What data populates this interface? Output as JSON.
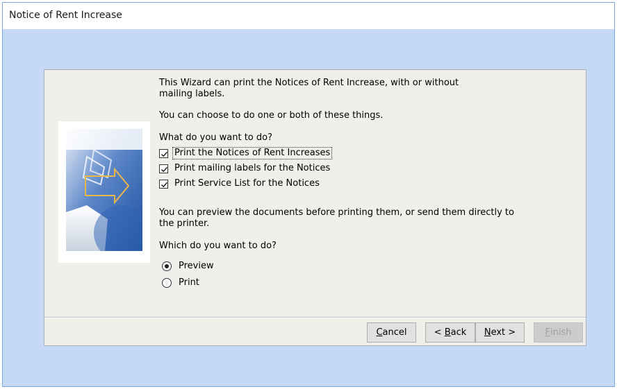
{
  "window": {
    "title": "Notice of Rent Increase"
  },
  "intro": {
    "line1": "This Wizard can print the Notices of Rent Increase, with or without",
    "line2": "mailing labels.",
    "line3": "You can choose to do one or both of these things."
  },
  "what_question": "What do you want to do?",
  "options": [
    {
      "label": "Print the Notices of Rent Increases",
      "checked": true
    },
    {
      "label": "Print mailing labels for the Notices",
      "checked": true
    },
    {
      "label": "Print Service List for the Notices",
      "checked": true
    }
  ],
  "preview_text": {
    "line1": "You can preview the documents before printing them, or send them directly to",
    "line2": "the printer."
  },
  "which_question": "Which do you want to do?",
  "radios": [
    {
      "label": "Preview",
      "selected": true
    },
    {
      "label": "Print",
      "selected": false
    }
  ],
  "buttons": {
    "cancel": {
      "underline": "C",
      "rest": "ancel"
    },
    "back": {
      "prefix": "< ",
      "underline": "B",
      "rest": "ack"
    },
    "next": {
      "underline": "N",
      "rest": "ext >"
    },
    "finish": {
      "underline": "F",
      "rest": "inish",
      "enabled": false
    }
  },
  "colors": {
    "window_bg": "#c5d9f6",
    "panel_bg": "#f0efea",
    "button_bg": "#e1e1e1"
  }
}
